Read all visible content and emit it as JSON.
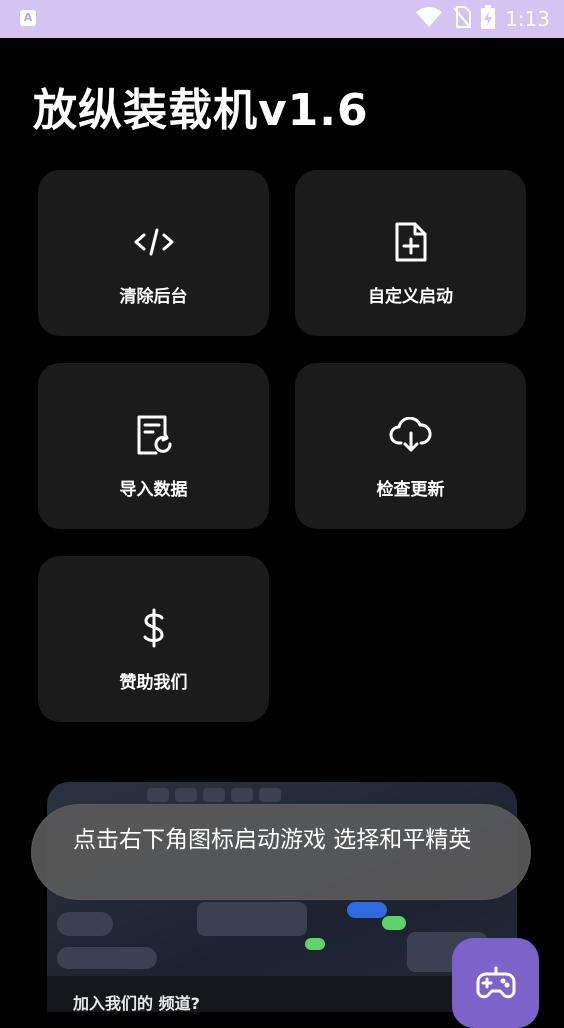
{
  "status_bar": {
    "time": "1:13",
    "app_badge": "A"
  },
  "app": {
    "title": "放纵装载机v1.6"
  },
  "menu": {
    "clear_background": "清除后台",
    "custom_launch": "自定义启动",
    "import_data": "导入数据",
    "check_update": "检查更新",
    "sponsor": "赞助我们"
  },
  "banner": {
    "caption": "加入我们的 频道?"
  },
  "toast": {
    "message": "点击右下角图标启动游戏 选择和平精英"
  },
  "colors": {
    "status_bar": "#d5c4f2",
    "card": "#1b1b1b",
    "fab": "#7d62c9"
  }
}
